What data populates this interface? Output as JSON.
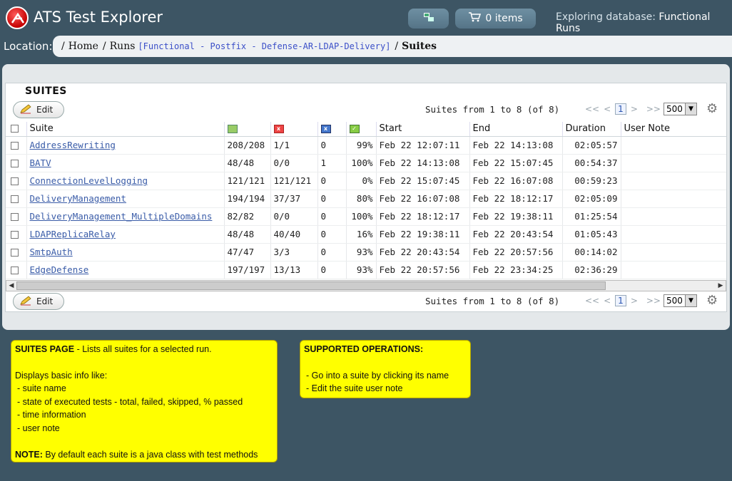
{
  "header": {
    "app_title": "ATS Test Explorer",
    "cart_label": "0 items",
    "exploring_label": "Exploring database:",
    "database_name": "Functional Runs"
  },
  "location": {
    "label": "Location:",
    "home": "Home",
    "runs": "Runs",
    "run_name": "[Functional - Postfix - Defense-AR-LDAP-Delivery]",
    "current": "Suites"
  },
  "suites": {
    "title": "SUITES",
    "edit_label": "Edit",
    "pager_text": "Suites from 1 to 8 (of 8)",
    "nav_first": "<<",
    "nav_prev": "<",
    "current_page": "1",
    "nav_next": ">",
    "nav_last": ">>",
    "page_size": "500",
    "columns": {
      "suite": "Suite",
      "start": "Start",
      "end": "End",
      "duration": "Duration",
      "user_note": "User Note"
    },
    "rows": [
      {
        "name": "AddressRewriting",
        "total": "208/208",
        "failed": "1/1",
        "skipped": "0",
        "passed": "99%",
        "start": "Feb 22 12:07:11",
        "end": "Feb 22 14:13:08",
        "duration": "02:05:57"
      },
      {
        "name": "BATV",
        "total": "48/48",
        "failed": "0/0",
        "skipped": "1",
        "passed": "100%",
        "start": "Feb 22 14:13:08",
        "end": "Feb 22 15:07:45",
        "duration": "00:54:37"
      },
      {
        "name": "ConnectionLevelLogging",
        "total": "121/121",
        "failed": "121/121",
        "skipped": "0",
        "passed": "0%",
        "start": "Feb 22 15:07:45",
        "end": "Feb 22 16:07:08",
        "duration": "00:59:23"
      },
      {
        "name": "DeliveryManagement",
        "total": "194/194",
        "failed": "37/37",
        "skipped": "0",
        "passed": "80%",
        "start": "Feb 22 16:07:08",
        "end": "Feb 22 18:12:17",
        "duration": "02:05:09"
      },
      {
        "name": "DeliveryManagement_MultipleDomains",
        "total": "82/82",
        "failed": "0/0",
        "skipped": "0",
        "passed": "100%",
        "start": "Feb 22 18:12:17",
        "end": "Feb 22 19:38:11",
        "duration": "01:25:54"
      },
      {
        "name": "LDAPReplicaRelay",
        "total": "48/48",
        "failed": "40/40",
        "skipped": "0",
        "passed": "16%",
        "start": "Feb 22 19:38:11",
        "end": "Feb 22 20:43:54",
        "duration": "01:05:43"
      },
      {
        "name": "SmtpAuth",
        "total": "47/47",
        "failed": "3/3",
        "skipped": "0",
        "passed": "93%",
        "start": "Feb 22 20:43:54",
        "end": "Feb 22 20:57:56",
        "duration": "00:14:02"
      },
      {
        "name": "EdgeDefense",
        "total": "197/197",
        "failed": "13/13",
        "skipped": "0",
        "passed": "93%",
        "start": "Feb 22 20:57:56",
        "end": "Feb 22 23:34:25",
        "duration": "02:36:29"
      }
    ]
  },
  "notes": {
    "left": {
      "heading": "SUITES PAGE",
      "heading_rest": " - Lists all suites for a selected run.",
      "intro": "Displays basic info like:",
      "items": [
        "- suite name",
        "- state of executed tests - total, failed, skipped, % passed",
        "- time information",
        "- user note"
      ],
      "note_label": "NOTE:",
      "note_text": " By default each suite is a java class with test methods"
    },
    "right": {
      "heading": "SUPPORTED OPERATIONS:",
      "items": [
        "- Go into a suite by clicking its name",
        "- Edit the suite user note"
      ]
    }
  },
  "icons": {
    "logo": "ats-logo-icon",
    "database": "database-icon",
    "cart": "cart-icon",
    "edit": "pencil-icon",
    "settings": "gear-icon",
    "total": "tests-total-icon",
    "failed": "tests-failed-icon",
    "skipped": "tests-skipped-icon",
    "passed": "tests-passed-icon"
  }
}
